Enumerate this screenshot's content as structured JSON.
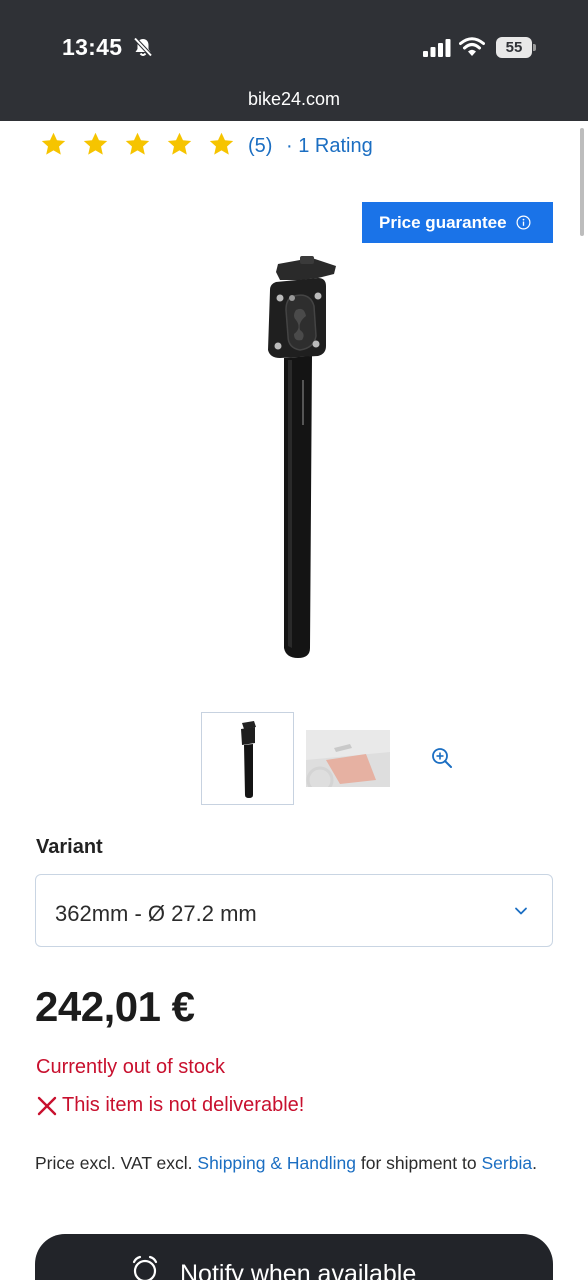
{
  "status_bar": {
    "time": "13:45",
    "battery": "55",
    "icons": [
      "bell-slash-icon",
      "signal-icon",
      "wifi-icon",
      "battery-icon"
    ]
  },
  "browser": {
    "url": "bike24.com"
  },
  "rating": {
    "stars": 5,
    "count_text": "(5)",
    "label": "· 1 Rating",
    "star_color": "#f6c400"
  },
  "badge": {
    "label": "Price guarantee"
  },
  "product": {
    "image_icon": "seatpost-image",
    "thumbnails": [
      "seatpost-thumbnail",
      "bike-thumbnail"
    ]
  },
  "variant": {
    "label": "Variant",
    "selected": "362mm - Ø 27.2 mm"
  },
  "price": {
    "value": "242,01 €"
  },
  "availability": {
    "stock": "Currently out of stock",
    "deliverable": "This item is not deliverable!"
  },
  "shipping": {
    "prefix": "Price excl. VAT excl. ",
    "link": "Shipping & Handling",
    "middle": " for shipment to ",
    "country": "Serbia",
    "suffix": "."
  },
  "notify_button": {
    "label": "Notify when available"
  },
  "colors": {
    "accent": "#1a73e8",
    "link": "#1b6ec2",
    "error": "#c8102e",
    "header": "#2f3136"
  }
}
